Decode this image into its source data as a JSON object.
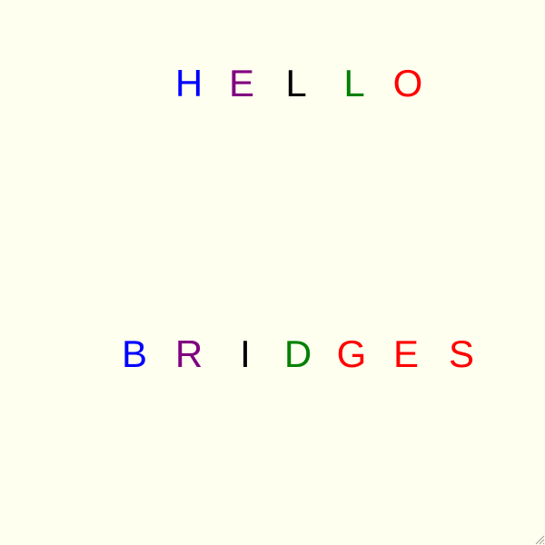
{
  "words": [
    {
      "letters": [
        {
          "char": "H",
          "color": "#0000ff"
        },
        {
          "char": "E",
          "color": "#800080"
        },
        {
          "char": "L",
          "color": "#000000"
        },
        {
          "char": "L",
          "color": "#008000"
        },
        {
          "char": "O",
          "color": "#ff0000"
        }
      ]
    },
    {
      "letters": [
        {
          "char": "B",
          "color": "#0000ff"
        },
        {
          "char": "R",
          "color": "#800080"
        },
        {
          "char": "I",
          "color": "#000000"
        },
        {
          "char": "D",
          "color": "#008000"
        },
        {
          "char": "G",
          "color": "#ff0000"
        },
        {
          "char": "E",
          "color": "#ff0000"
        },
        {
          "char": "S",
          "color": "#ff0000"
        }
      ]
    }
  ],
  "background_color": "#fffff0",
  "resize_grip_icon": "resize-grip-icon"
}
